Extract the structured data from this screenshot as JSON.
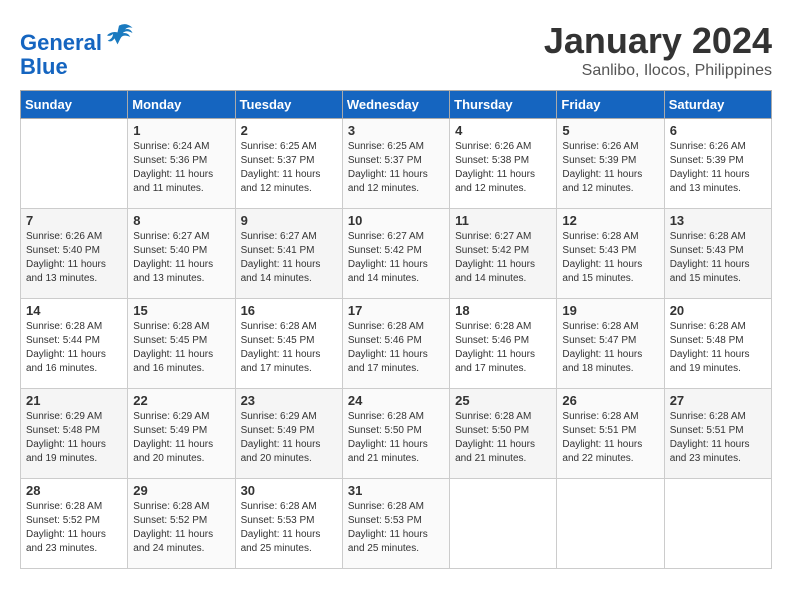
{
  "logo": {
    "line1": "General",
    "line2": "Blue"
  },
  "title": "January 2024",
  "subtitle": "Sanlibo, Ilocos, Philippines",
  "days_of_week": [
    "Sunday",
    "Monday",
    "Tuesday",
    "Wednesday",
    "Thursday",
    "Friday",
    "Saturday"
  ],
  "weeks": [
    [
      {
        "day": "",
        "info": ""
      },
      {
        "day": "1",
        "sunrise": "Sunrise: 6:24 AM",
        "sunset": "Sunset: 5:36 PM",
        "daylight": "Daylight: 11 hours and 11 minutes."
      },
      {
        "day": "2",
        "sunrise": "Sunrise: 6:25 AM",
        "sunset": "Sunset: 5:37 PM",
        "daylight": "Daylight: 11 hours and 12 minutes."
      },
      {
        "day": "3",
        "sunrise": "Sunrise: 6:25 AM",
        "sunset": "Sunset: 5:37 PM",
        "daylight": "Daylight: 11 hours and 12 minutes."
      },
      {
        "day": "4",
        "sunrise": "Sunrise: 6:26 AM",
        "sunset": "Sunset: 5:38 PM",
        "daylight": "Daylight: 11 hours and 12 minutes."
      },
      {
        "day": "5",
        "sunrise": "Sunrise: 6:26 AM",
        "sunset": "Sunset: 5:39 PM",
        "daylight": "Daylight: 11 hours and 12 minutes."
      },
      {
        "day": "6",
        "sunrise": "Sunrise: 6:26 AM",
        "sunset": "Sunset: 5:39 PM",
        "daylight": "Daylight: 11 hours and 13 minutes."
      }
    ],
    [
      {
        "day": "7",
        "sunrise": "Sunrise: 6:26 AM",
        "sunset": "Sunset: 5:40 PM",
        "daylight": "Daylight: 11 hours and 13 minutes."
      },
      {
        "day": "8",
        "sunrise": "Sunrise: 6:27 AM",
        "sunset": "Sunset: 5:40 PM",
        "daylight": "Daylight: 11 hours and 13 minutes."
      },
      {
        "day": "9",
        "sunrise": "Sunrise: 6:27 AM",
        "sunset": "Sunset: 5:41 PM",
        "daylight": "Daylight: 11 hours and 14 minutes."
      },
      {
        "day": "10",
        "sunrise": "Sunrise: 6:27 AM",
        "sunset": "Sunset: 5:42 PM",
        "daylight": "Daylight: 11 hours and 14 minutes."
      },
      {
        "day": "11",
        "sunrise": "Sunrise: 6:27 AM",
        "sunset": "Sunset: 5:42 PM",
        "daylight": "Daylight: 11 hours and 14 minutes."
      },
      {
        "day": "12",
        "sunrise": "Sunrise: 6:28 AM",
        "sunset": "Sunset: 5:43 PM",
        "daylight": "Daylight: 11 hours and 15 minutes."
      },
      {
        "day": "13",
        "sunrise": "Sunrise: 6:28 AM",
        "sunset": "Sunset: 5:43 PM",
        "daylight": "Daylight: 11 hours and 15 minutes."
      }
    ],
    [
      {
        "day": "14",
        "sunrise": "Sunrise: 6:28 AM",
        "sunset": "Sunset: 5:44 PM",
        "daylight": "Daylight: 11 hours and 16 minutes."
      },
      {
        "day": "15",
        "sunrise": "Sunrise: 6:28 AM",
        "sunset": "Sunset: 5:45 PM",
        "daylight": "Daylight: 11 hours and 16 minutes."
      },
      {
        "day": "16",
        "sunrise": "Sunrise: 6:28 AM",
        "sunset": "Sunset: 5:45 PM",
        "daylight": "Daylight: 11 hours and 17 minutes."
      },
      {
        "day": "17",
        "sunrise": "Sunrise: 6:28 AM",
        "sunset": "Sunset: 5:46 PM",
        "daylight": "Daylight: 11 hours and 17 minutes."
      },
      {
        "day": "18",
        "sunrise": "Sunrise: 6:28 AM",
        "sunset": "Sunset: 5:46 PM",
        "daylight": "Daylight: 11 hours and 17 minutes."
      },
      {
        "day": "19",
        "sunrise": "Sunrise: 6:28 AM",
        "sunset": "Sunset: 5:47 PM",
        "daylight": "Daylight: 11 hours and 18 minutes."
      },
      {
        "day": "20",
        "sunrise": "Sunrise: 6:28 AM",
        "sunset": "Sunset: 5:48 PM",
        "daylight": "Daylight: 11 hours and 19 minutes."
      }
    ],
    [
      {
        "day": "21",
        "sunrise": "Sunrise: 6:29 AM",
        "sunset": "Sunset: 5:48 PM",
        "daylight": "Daylight: 11 hours and 19 minutes."
      },
      {
        "day": "22",
        "sunrise": "Sunrise: 6:29 AM",
        "sunset": "Sunset: 5:49 PM",
        "daylight": "Daylight: 11 hours and 20 minutes."
      },
      {
        "day": "23",
        "sunrise": "Sunrise: 6:29 AM",
        "sunset": "Sunset: 5:49 PM",
        "daylight": "Daylight: 11 hours and 20 minutes."
      },
      {
        "day": "24",
        "sunrise": "Sunrise: 6:28 AM",
        "sunset": "Sunset: 5:50 PM",
        "daylight": "Daylight: 11 hours and 21 minutes."
      },
      {
        "day": "25",
        "sunrise": "Sunrise: 6:28 AM",
        "sunset": "Sunset: 5:50 PM",
        "daylight": "Daylight: 11 hours and 21 minutes."
      },
      {
        "day": "26",
        "sunrise": "Sunrise: 6:28 AM",
        "sunset": "Sunset: 5:51 PM",
        "daylight": "Daylight: 11 hours and 22 minutes."
      },
      {
        "day": "27",
        "sunrise": "Sunrise: 6:28 AM",
        "sunset": "Sunset: 5:51 PM",
        "daylight": "Daylight: 11 hours and 23 minutes."
      }
    ],
    [
      {
        "day": "28",
        "sunrise": "Sunrise: 6:28 AM",
        "sunset": "Sunset: 5:52 PM",
        "daylight": "Daylight: 11 hours and 23 minutes."
      },
      {
        "day": "29",
        "sunrise": "Sunrise: 6:28 AM",
        "sunset": "Sunset: 5:52 PM",
        "daylight": "Daylight: 11 hours and 24 minutes."
      },
      {
        "day": "30",
        "sunrise": "Sunrise: 6:28 AM",
        "sunset": "Sunset: 5:53 PM",
        "daylight": "Daylight: 11 hours and 25 minutes."
      },
      {
        "day": "31",
        "sunrise": "Sunrise: 6:28 AM",
        "sunset": "Sunset: 5:53 PM",
        "daylight": "Daylight: 11 hours and 25 minutes."
      },
      {
        "day": "",
        "info": ""
      },
      {
        "day": "",
        "info": ""
      },
      {
        "day": "",
        "info": ""
      }
    ]
  ]
}
